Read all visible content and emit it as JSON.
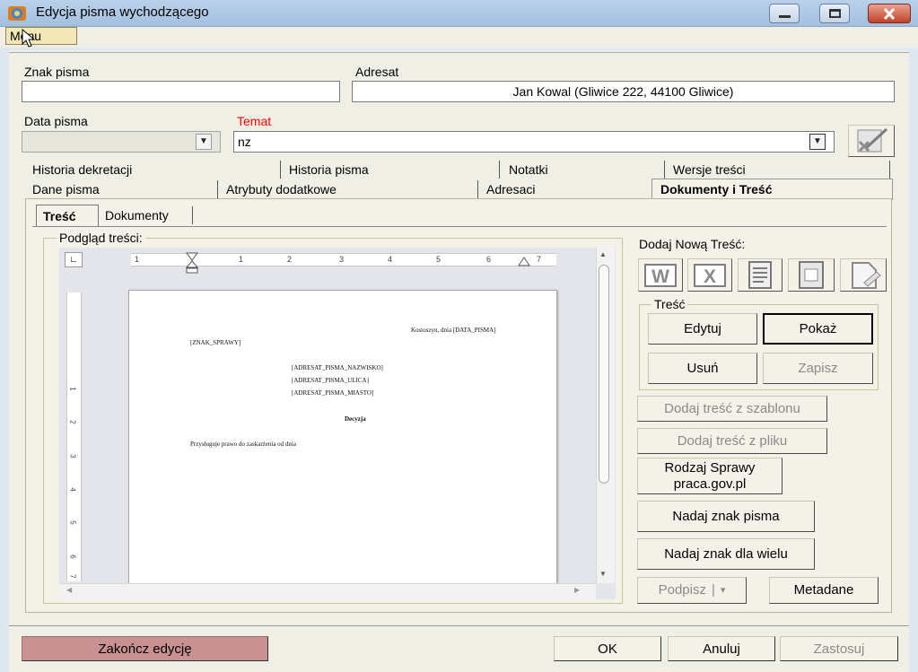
{
  "window": {
    "title": "Edycja pisma wychodzącego",
    "minimize": "—",
    "maximize": "▭",
    "close": "✕"
  },
  "menu": {
    "label": "Menu"
  },
  "form": {
    "znak_label": "Znak pisma",
    "znak_value": "",
    "adresat_label": "Adresat",
    "adresat_value": "Jan Kowal (Gliwice 222, 44100 Gliwice)",
    "data_label": "Data pisma",
    "data_value": "",
    "temat_label": "Temat",
    "temat_value": "nz"
  },
  "tabs_top": [
    "Historia dekretacji",
    "Historia pisma",
    "Notatki",
    "Wersje treści"
  ],
  "tabs_bottom": [
    "Dane pisma",
    "Atrybuty dodatkowe",
    "Adresaci",
    "Dokumenty i Treść"
  ],
  "subtabs": [
    "Treść",
    "Dokumenty"
  ],
  "preview": {
    "title": "Podgląd treści:",
    "ruler_numbers": [
      "1",
      "1",
      "2",
      "3",
      "4",
      "5",
      "6",
      "7"
    ],
    "vruler_numbers": [
      "1",
      "2",
      "3",
      "4",
      "5",
      "6",
      "7"
    ],
    "doc": {
      "place_date": "Kostoszyn, dnia [DATA_PISMA]",
      "znak": "[ZNAK_SPRAWY]",
      "addr_name": "[ADRESAT_PISMA_NAZWISKO]",
      "addr_street": "[ADRESAT_PISMA_ULICA]",
      "addr_city": "[ADRESAT_PISMA_MIASTO]",
      "heading": "Decyzja",
      "body": "Przysługuje prawo do zaskarżenia od dnia"
    }
  },
  "right": {
    "add_new": "Dodaj Nową Treść:",
    "tresc_group": "Treść",
    "edytuj": "Edytuj",
    "pokaz": "Pokaż",
    "usun": "Usuń",
    "zapisz": "Zapisz",
    "z_szablonu": "Dodaj treść z szablonu",
    "z_pliku": "Dodaj treść z pliku",
    "rodzaj_line1": "Rodzaj Sprawy",
    "rodzaj_line2": "praca.gov.pl",
    "nadaj_znak": "Nadaj znak pisma",
    "nadaj_wielu": "Nadaj znak dla wielu",
    "podpisz": "Podpisz",
    "podpisz_arrow": "▾",
    "metadane": "Metadane"
  },
  "footer": {
    "zakoncz": "Zakończ edycję",
    "ok": "OK",
    "anuluj": "Anuluj",
    "zastosuj": "Zastosuj"
  },
  "colors": {
    "zakoncz_bg": "#c99191",
    "label_red": "#ff0000",
    "group_border": "#c8c49b"
  }
}
